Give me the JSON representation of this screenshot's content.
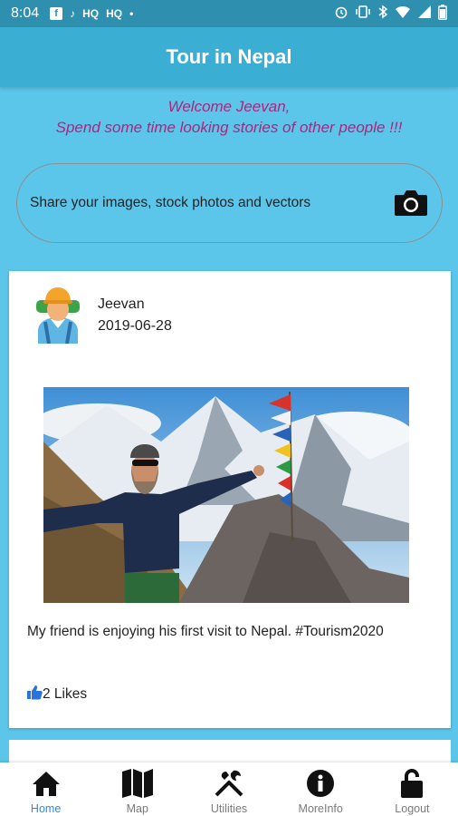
{
  "status_bar": {
    "time": "8:04",
    "left_icons": [
      "facebook-icon",
      "tiktok-icon",
      "hq-icon",
      "hq-icon",
      "dot-icon"
    ],
    "hq_label": "HQ",
    "right_icons": [
      "alarm-icon",
      "vibrate-icon",
      "bluetooth-icon",
      "wifi-icon",
      "signal-icon",
      "battery-icon"
    ]
  },
  "app_bar": {
    "title": "Tour in Nepal"
  },
  "welcome": {
    "line1": "Welcome Jeevan,",
    "line2": "Spend some time looking stories of other people !!!"
  },
  "share": {
    "text": "Share your images, stock photos and vectors",
    "icon": "camera-icon"
  },
  "post": {
    "user": "Jeevan",
    "date": "2019-06-28",
    "caption": "My friend is enjoying his first visit to Nepal. #Tourism2020",
    "likes_label": "2 Likes",
    "likes_icon": "thumbs-up-icon"
  },
  "nav": {
    "items": [
      {
        "label": "Home",
        "icon": "home-icon",
        "active": true
      },
      {
        "label": "Map",
        "icon": "map-icon",
        "active": false
      },
      {
        "label": "Utilities",
        "icon": "tools-icon",
        "active": false
      },
      {
        "label": "MoreInfo",
        "icon": "info-icon",
        "active": false
      },
      {
        "label": "Logout",
        "icon": "unlock-icon",
        "active": false
      }
    ]
  },
  "colors": {
    "background": "#5cc6ea",
    "app_bar": "#3aaed3",
    "status_bar": "#2f8fae",
    "welcome_text": "#b0247f",
    "nav_active": "#2a8fd0"
  }
}
